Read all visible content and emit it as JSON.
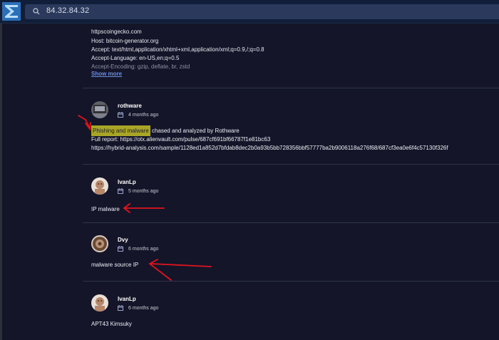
{
  "search": {
    "value": "84.32.84.32"
  },
  "header_block": {
    "lines": [
      "httpscoingecko.com",
      "Host: bitcoin-generator.org",
      "Accept: text/html,application/xhtml+xml,application/xml;q=0.9,/;q=0.8",
      "Accept-Language: en-US,en;q=0.5",
      "Accept-Encoding: gzip, deflate, br, zstd"
    ],
    "show_more": "Show more"
  },
  "comments": [
    {
      "username": "rothware",
      "date": "4 months ago",
      "highlight": "Phishing and malware",
      "text_after_highlight": " chased and analyzed by Rothware",
      "lines": [
        "Full report: https://otx.alienvault.com/pulse/687cf691bf66787f1e81bc63",
        "https://hybrid-analysis.com/sample/1128ed1a852d7bfdab8dec2b0a93b5bb728356bbf57777ba2b9006118a276f68/687cf3ea0e6f4c57130f326f"
      ]
    },
    {
      "username": "IvanLp",
      "date": "5 months ago",
      "text": "IP malware"
    },
    {
      "username": "Dvy",
      "date": "6 months ago",
      "text": "malware source IP"
    },
    {
      "username": "IvanLp",
      "date": "6 months ago",
      "text": "APT43 Kimsuky"
    }
  ],
  "colors": {
    "background": "#15152a",
    "topbar": "#101e3a",
    "search_box": "#2b3a5c",
    "link": "#6c8fd9",
    "highlight": "#a9a627",
    "annotation_arrow": "#e0141e"
  },
  "icons": [
    "logo-icon",
    "search-icon",
    "calendar-icon",
    "avatar",
    "red-arrow-annotation"
  ]
}
